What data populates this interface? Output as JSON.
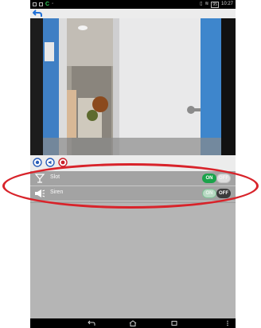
{
  "status_bar": {
    "time": "10:27",
    "carrier_badge": "C",
    "battery": "95"
  },
  "camera": {
    "label": "camera-feed"
  },
  "controls": [
    "record",
    "audio",
    "snapshot"
  ],
  "list": {
    "items": [
      {
        "label": "Slot",
        "icon": "chalice-icon",
        "on_label": "ON",
        "off_label": "OFF",
        "state": "on"
      },
      {
        "label": "Siren",
        "icon": "siren-icon",
        "on_label": "ON",
        "off_label": "OFF",
        "state": "off"
      }
    ]
  },
  "colors": {
    "toggle_on": "#1aa34a",
    "toggle_off": "#3b3b3b",
    "highlight": "#d8232a"
  }
}
